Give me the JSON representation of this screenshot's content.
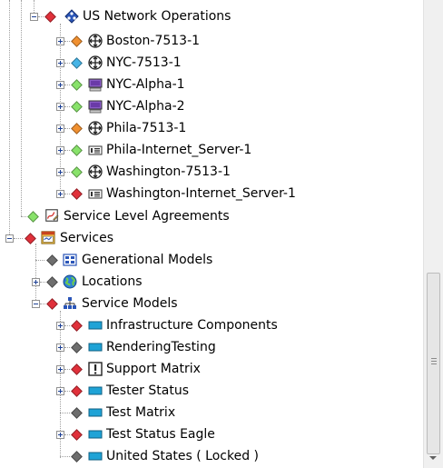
{
  "tree": {
    "network_ops": {
      "label": "US Network Operations",
      "status_color": "#e0303a",
      "children": [
        {
          "label": "Boston-7513-1",
          "status_color": "#f09030",
          "icon": "router-icon"
        },
        {
          "label": "NYC-7513-1",
          "status_color": "#46b4e6",
          "icon": "router-icon"
        },
        {
          "label": "NYC-Alpha-1",
          "status_color": "#88e26a",
          "icon": "workstation-icon"
        },
        {
          "label": "NYC-Alpha-2",
          "status_color": "#88e26a",
          "icon": "workstation-icon"
        },
        {
          "label": "Phila-7513-1",
          "status_color": "#f09030",
          "icon": "router-icon"
        },
        {
          "label": "Phila-Internet_Server-1",
          "status_color": "#88e26a",
          "icon": "server-icon"
        },
        {
          "label": "Washington-7513-1",
          "status_color": "#88e26a",
          "icon": "router-icon"
        },
        {
          "label": "Washington-Internet_Server-1",
          "status_color": "#e0303a",
          "icon": "server-icon"
        }
      ]
    },
    "sla": {
      "label": "Service Level Agreements",
      "status_color": "#88e26a",
      "icon": "agreement-icon"
    },
    "services": {
      "label": "Services",
      "status_color": "#e0303a",
      "icon": "services-calendar-icon",
      "children": [
        {
          "label": "Generational Models",
          "status_color": "#6e6e6e",
          "icon": "models-grid-icon"
        },
        {
          "label": "Locations",
          "status_color": "#6e6e6e",
          "icon": "globe-icon"
        },
        {
          "label": "Service Models",
          "status_color": "#e0303a",
          "icon": "hierarchy-icon",
          "children": [
            {
              "label": "Infrastructure Components",
              "status_color": "#e0303a",
              "icon": "service-bar-icon"
            },
            {
              "label": "RenderingTesting",
              "status_color": "#6e6e6e",
              "icon": "service-bar-icon"
            },
            {
              "label": "Support Matrix",
              "status_color": "#e0303a",
              "icon": "alert-icon"
            },
            {
              "label": "Tester Status",
              "status_color": "#e0303a",
              "icon": "service-bar-icon"
            },
            {
              "label": "Test Matrix",
              "status_color": "#6e6e6e",
              "icon": "service-bar-icon"
            },
            {
              "label": "Test Status Eagle",
              "status_color": "#e0303a",
              "icon": "service-bar-icon"
            },
            {
              "label": "United States ( Locked )",
              "status_color": "#6e6e6e",
              "icon": "service-bar-icon"
            }
          ]
        }
      ]
    }
  }
}
